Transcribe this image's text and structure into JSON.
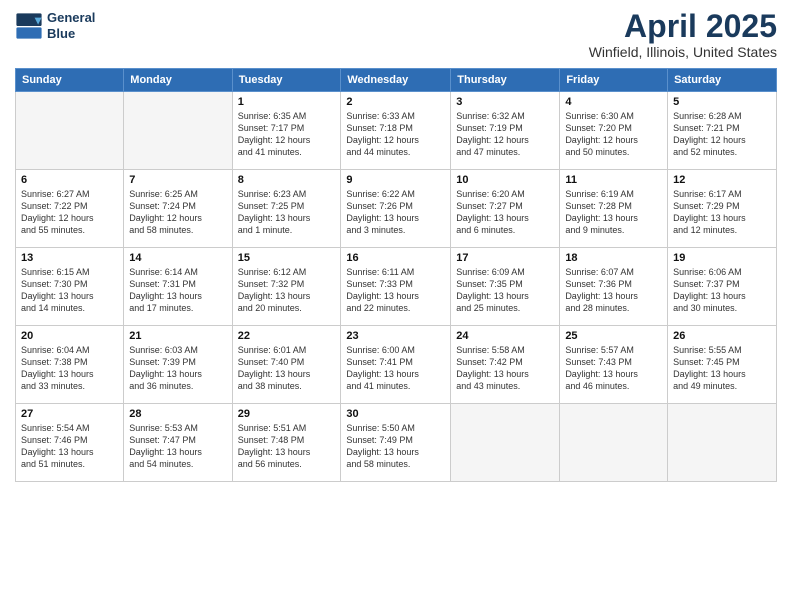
{
  "header": {
    "logo_line1": "General",
    "logo_line2": "Blue",
    "month": "April 2025",
    "location": "Winfield, Illinois, United States"
  },
  "days_of_week": [
    "Sunday",
    "Monday",
    "Tuesday",
    "Wednesday",
    "Thursday",
    "Friday",
    "Saturday"
  ],
  "weeks": [
    [
      {
        "num": "",
        "info": ""
      },
      {
        "num": "",
        "info": ""
      },
      {
        "num": "1",
        "info": "Sunrise: 6:35 AM\nSunset: 7:17 PM\nDaylight: 12 hours\nand 41 minutes."
      },
      {
        "num": "2",
        "info": "Sunrise: 6:33 AM\nSunset: 7:18 PM\nDaylight: 12 hours\nand 44 minutes."
      },
      {
        "num": "3",
        "info": "Sunrise: 6:32 AM\nSunset: 7:19 PM\nDaylight: 12 hours\nand 47 minutes."
      },
      {
        "num": "4",
        "info": "Sunrise: 6:30 AM\nSunset: 7:20 PM\nDaylight: 12 hours\nand 50 minutes."
      },
      {
        "num": "5",
        "info": "Sunrise: 6:28 AM\nSunset: 7:21 PM\nDaylight: 12 hours\nand 52 minutes."
      }
    ],
    [
      {
        "num": "6",
        "info": "Sunrise: 6:27 AM\nSunset: 7:22 PM\nDaylight: 12 hours\nand 55 minutes."
      },
      {
        "num": "7",
        "info": "Sunrise: 6:25 AM\nSunset: 7:24 PM\nDaylight: 12 hours\nand 58 minutes."
      },
      {
        "num": "8",
        "info": "Sunrise: 6:23 AM\nSunset: 7:25 PM\nDaylight: 13 hours\nand 1 minute."
      },
      {
        "num": "9",
        "info": "Sunrise: 6:22 AM\nSunset: 7:26 PM\nDaylight: 13 hours\nand 3 minutes."
      },
      {
        "num": "10",
        "info": "Sunrise: 6:20 AM\nSunset: 7:27 PM\nDaylight: 13 hours\nand 6 minutes."
      },
      {
        "num": "11",
        "info": "Sunrise: 6:19 AM\nSunset: 7:28 PM\nDaylight: 13 hours\nand 9 minutes."
      },
      {
        "num": "12",
        "info": "Sunrise: 6:17 AM\nSunset: 7:29 PM\nDaylight: 13 hours\nand 12 minutes."
      }
    ],
    [
      {
        "num": "13",
        "info": "Sunrise: 6:15 AM\nSunset: 7:30 PM\nDaylight: 13 hours\nand 14 minutes."
      },
      {
        "num": "14",
        "info": "Sunrise: 6:14 AM\nSunset: 7:31 PM\nDaylight: 13 hours\nand 17 minutes."
      },
      {
        "num": "15",
        "info": "Sunrise: 6:12 AM\nSunset: 7:32 PM\nDaylight: 13 hours\nand 20 minutes."
      },
      {
        "num": "16",
        "info": "Sunrise: 6:11 AM\nSunset: 7:33 PM\nDaylight: 13 hours\nand 22 minutes."
      },
      {
        "num": "17",
        "info": "Sunrise: 6:09 AM\nSunset: 7:35 PM\nDaylight: 13 hours\nand 25 minutes."
      },
      {
        "num": "18",
        "info": "Sunrise: 6:07 AM\nSunset: 7:36 PM\nDaylight: 13 hours\nand 28 minutes."
      },
      {
        "num": "19",
        "info": "Sunrise: 6:06 AM\nSunset: 7:37 PM\nDaylight: 13 hours\nand 30 minutes."
      }
    ],
    [
      {
        "num": "20",
        "info": "Sunrise: 6:04 AM\nSunset: 7:38 PM\nDaylight: 13 hours\nand 33 minutes."
      },
      {
        "num": "21",
        "info": "Sunrise: 6:03 AM\nSunset: 7:39 PM\nDaylight: 13 hours\nand 36 minutes."
      },
      {
        "num": "22",
        "info": "Sunrise: 6:01 AM\nSunset: 7:40 PM\nDaylight: 13 hours\nand 38 minutes."
      },
      {
        "num": "23",
        "info": "Sunrise: 6:00 AM\nSunset: 7:41 PM\nDaylight: 13 hours\nand 41 minutes."
      },
      {
        "num": "24",
        "info": "Sunrise: 5:58 AM\nSunset: 7:42 PM\nDaylight: 13 hours\nand 43 minutes."
      },
      {
        "num": "25",
        "info": "Sunrise: 5:57 AM\nSunset: 7:43 PM\nDaylight: 13 hours\nand 46 minutes."
      },
      {
        "num": "26",
        "info": "Sunrise: 5:55 AM\nSunset: 7:45 PM\nDaylight: 13 hours\nand 49 minutes."
      }
    ],
    [
      {
        "num": "27",
        "info": "Sunrise: 5:54 AM\nSunset: 7:46 PM\nDaylight: 13 hours\nand 51 minutes."
      },
      {
        "num": "28",
        "info": "Sunrise: 5:53 AM\nSunset: 7:47 PM\nDaylight: 13 hours\nand 54 minutes."
      },
      {
        "num": "29",
        "info": "Sunrise: 5:51 AM\nSunset: 7:48 PM\nDaylight: 13 hours\nand 56 minutes."
      },
      {
        "num": "30",
        "info": "Sunrise: 5:50 AM\nSunset: 7:49 PM\nDaylight: 13 hours\nand 58 minutes."
      },
      {
        "num": "",
        "info": ""
      },
      {
        "num": "",
        "info": ""
      },
      {
        "num": "",
        "info": ""
      }
    ]
  ]
}
